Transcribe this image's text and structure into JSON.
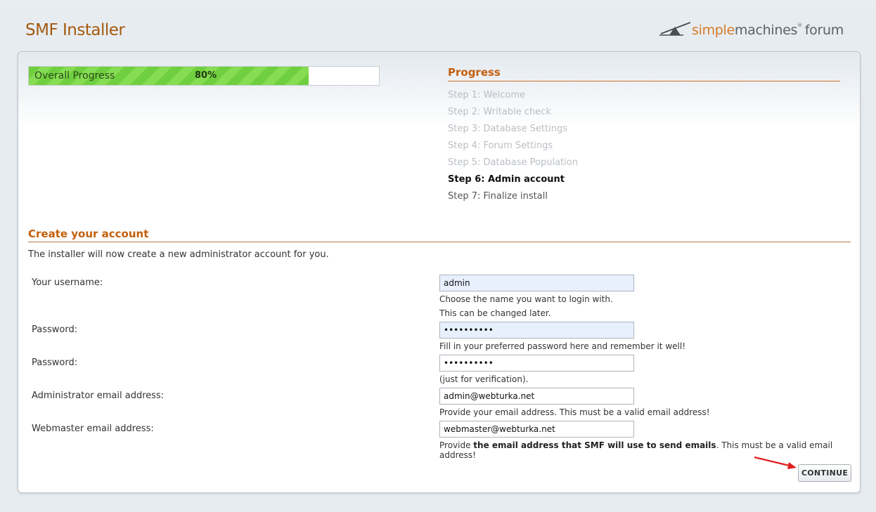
{
  "header": {
    "title": "SMF Installer",
    "logo": {
      "simple": "simple",
      "machines": "machines",
      "reg": "®",
      "forum": "forum"
    }
  },
  "progress": {
    "label": "Overall Progress",
    "percent_text": "80%",
    "fraction": 0.8
  },
  "steps": {
    "heading": "Progress",
    "items": [
      {
        "label": "Step 1: Welcome",
        "state": "done"
      },
      {
        "label": "Step 2: Writable check",
        "state": "done"
      },
      {
        "label": "Step 3: Database Settings",
        "state": "done"
      },
      {
        "label": "Step 4: Forum Settings",
        "state": "done"
      },
      {
        "label": "Step 5: Database Population",
        "state": "done"
      },
      {
        "label": "Step 6: Admin account",
        "state": "current"
      },
      {
        "label": "Step 7: Finalize install",
        "state": "todo"
      }
    ]
  },
  "form": {
    "title": "Create your account",
    "intro": "The installer will now create a new administrator account for you.",
    "username": {
      "label": "Your username:",
      "value": "admin",
      "hint1": "Choose the name you want to login with.",
      "hint2": "This can be changed later."
    },
    "password": {
      "label": "Password:",
      "value": "••••••••••",
      "hint": "Fill in your preferred password here and remember it well!"
    },
    "password_verify": {
      "label": "Password:",
      "value": "••••••••••",
      "hint": "(just for verification)."
    },
    "admin_email": {
      "label": "Administrator email address:",
      "value": "admin@webturka.net",
      "hint": "Provide your email address. This must be a valid email address!"
    },
    "webmaster_email": {
      "label": "Webmaster email address:",
      "value": "webmaster@webturka.net",
      "hint_pre": "Provide ",
      "hint_bold": "the email address that SMF will use to send emails",
      "hint_post": ". This must be a valid email address!"
    },
    "continue_label": "CONTINUE"
  },
  "colors": {
    "accent": "#c35f0d",
    "progress_green": "#6fcf3e",
    "annotation_arrow": "#e02020"
  },
  "icons": {
    "logo": "smf-logo-icon",
    "arrow": "red-arrow-icon"
  }
}
